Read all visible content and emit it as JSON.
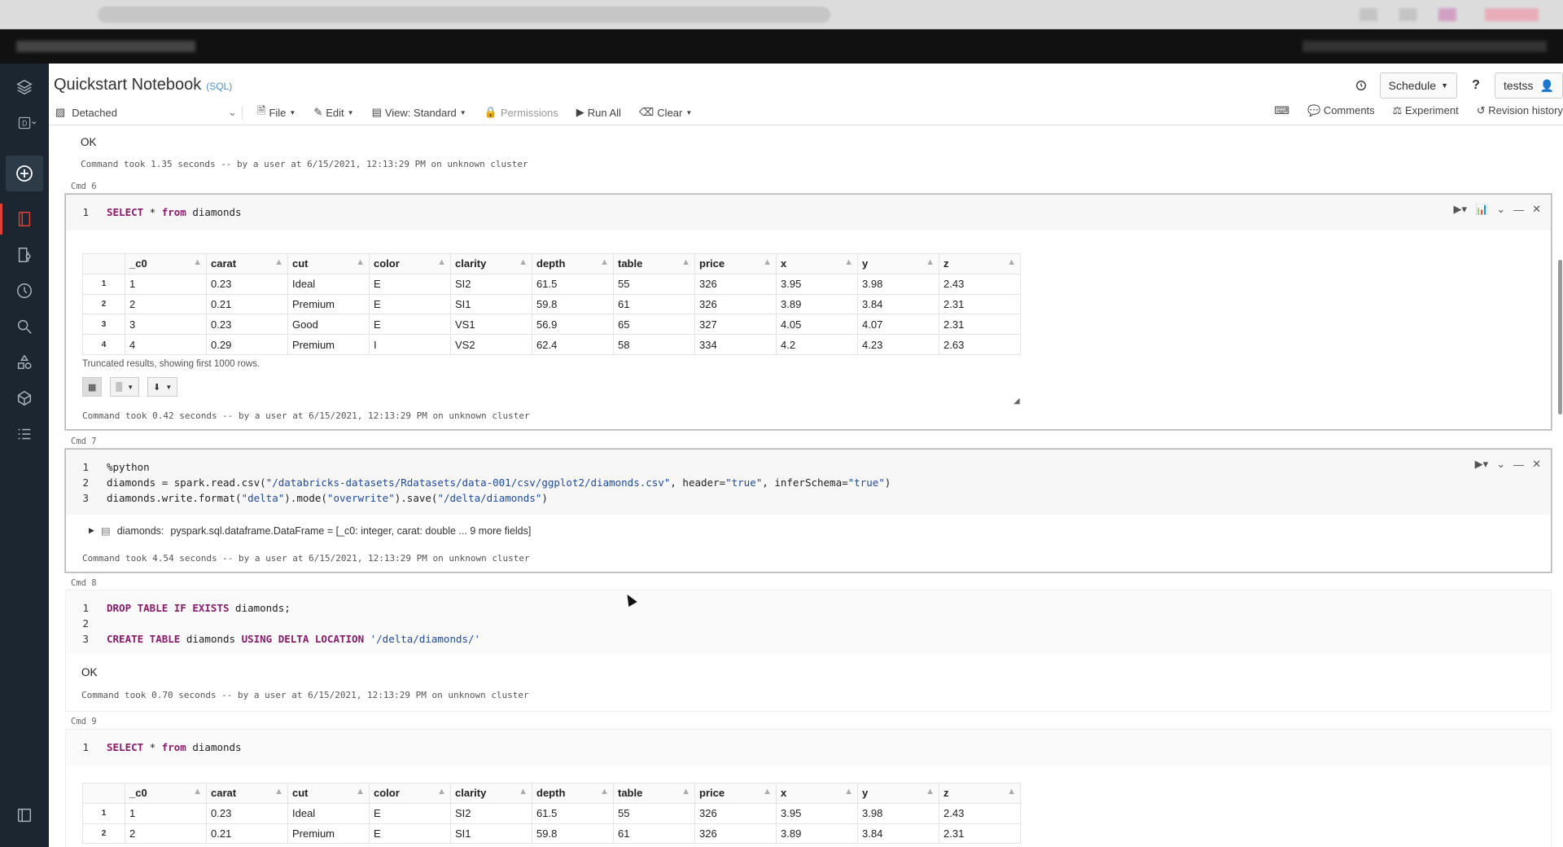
{
  "header": {
    "title": "Quickstart Notebook",
    "language_badge": "(SQL)",
    "schedule_label": "Schedule",
    "help_label": "?",
    "user_label": "testss"
  },
  "toolbar": {
    "cluster": "Detached",
    "file": "File",
    "edit": "Edit",
    "view": "View: Standard",
    "permissions": "Permissions",
    "run_all": "Run All",
    "clear": "Clear",
    "comments": "Comments",
    "experiment": "Experiment",
    "revision_history": "Revision history"
  },
  "cell5": {
    "output": "OK",
    "took": "Command took 1.35 seconds -- by a user at 6/15/2021, 12:13:29 PM on unknown cluster"
  },
  "cell6": {
    "label": "Cmd 6",
    "code": [
      {
        "n": "1",
        "kw1": "SELECT",
        "mid": " * ",
        "kw2": "from",
        "rest": " diamonds"
      }
    ],
    "columns": [
      "_c0",
      "carat",
      "cut",
      "color",
      "clarity",
      "depth",
      "table",
      "price",
      "x",
      "y",
      "z"
    ],
    "rows": [
      [
        "1",
        "1",
        "0.23",
        "Ideal",
        "E",
        "SI2",
        "61.5",
        "55",
        "326",
        "3.95",
        "3.98",
        "2.43"
      ],
      [
        "2",
        "2",
        "0.21",
        "Premium",
        "E",
        "SI1",
        "59.8",
        "61",
        "326",
        "3.89",
        "3.84",
        "2.31"
      ],
      [
        "3",
        "3",
        "0.23",
        "Good",
        "E",
        "VS1",
        "56.9",
        "65",
        "327",
        "4.05",
        "4.07",
        "2.31"
      ],
      [
        "4",
        "4",
        "0.29",
        "Premium",
        "I",
        "VS2",
        "62.4",
        "58",
        "334",
        "4.2",
        "4.23",
        "2.63"
      ]
    ],
    "truncated": "Truncated results, showing first 1000 rows.",
    "took": "Command took 0.42 seconds -- by a user at 6/15/2021, 12:13:29 PM on unknown cluster"
  },
  "cell7": {
    "label": "Cmd 7",
    "line1": "%python",
    "line2_a": "diamonds = spark.read.csv(",
    "line2_s1": "\"/databricks-datasets/Rdatasets/data-001/csv/ggplot2/diamonds.csv\"",
    "line2_b": ", header=",
    "line2_s2": "\"true\"",
    "line2_c": ", inferSchema=",
    "line2_s3": "\"true\"",
    "line2_d": ")",
    "line3_a": "diamonds.write.format(",
    "line3_s1": "\"delta\"",
    "line3_b": ").mode(",
    "line3_s2": "\"overwrite\"",
    "line3_c": ").save(",
    "line3_s3": "\"/delta/diamonds\"",
    "line3_d": ")",
    "df_name": "diamonds:",
    "df_type": "pyspark.sql.dataframe.DataFrame = [_c0: integer, carat: double ... 9 more fields]",
    "took": "Command took 4.54 seconds -- by a user at 6/15/2021, 12:13:29 PM on unknown cluster"
  },
  "cell8": {
    "label": "Cmd 8",
    "l1_kw": "DROP TABLE IF EXISTS",
    "l1_rest": " diamonds;",
    "l3_kw1": "CREATE TABLE",
    "l3_mid": " diamonds ",
    "l3_kw2": "USING DELTA LOCATION",
    "l3_str": " '/delta/diamonds/'",
    "output": "OK",
    "took": "Command took 0.70 seconds -- by a user at 6/15/2021, 12:13:29 PM on unknown cluster"
  },
  "cell9": {
    "label": "Cmd 9",
    "rows": [
      [
        "1",
        "1",
        "0.23",
        "Ideal",
        "E",
        "SI2",
        "61.5",
        "55",
        "326",
        "3.95",
        "3.98",
        "2.43"
      ],
      [
        "2",
        "2",
        "0.21",
        "Premium",
        "E",
        "SI1",
        "59.8",
        "61",
        "326",
        "3.89",
        "3.84",
        "2.31"
      ]
    ]
  }
}
